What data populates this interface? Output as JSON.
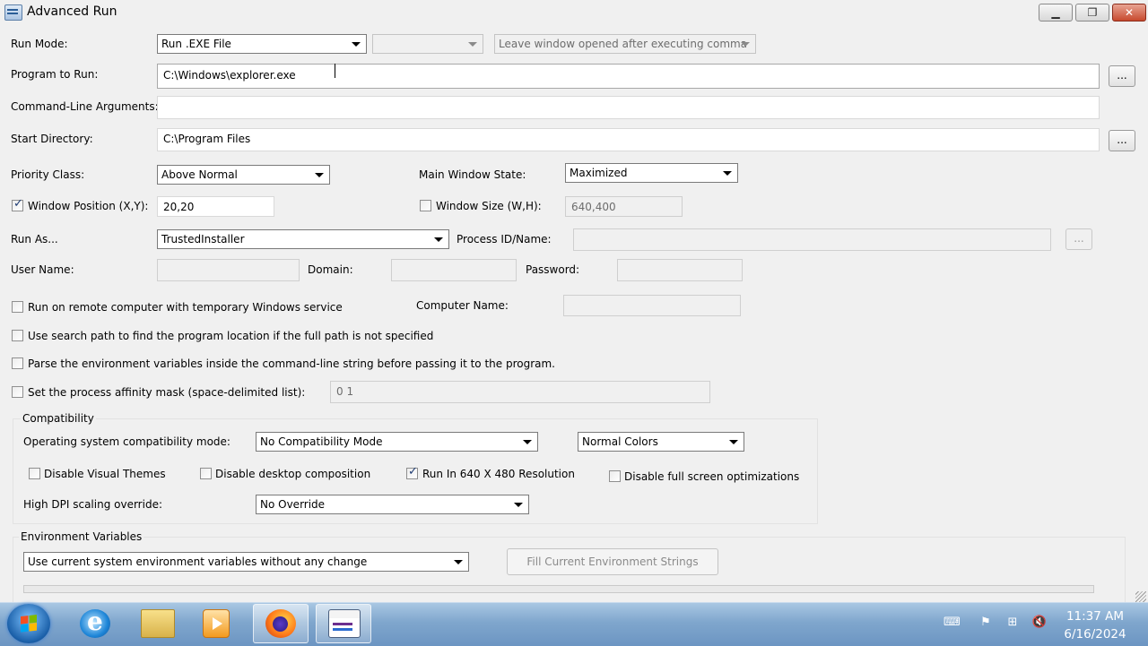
{
  "window": {
    "title": "Advanced Run",
    "minimize": "▁",
    "maximize": "❐",
    "close": "✕"
  },
  "run_mode": {
    "label": "Run Mode:",
    "value": "Run .EXE File",
    "secondary_value": "",
    "after_exec_value": "Leave window opened after executing comma"
  },
  "program": {
    "label": "Program to Run:",
    "value": "C:\\Windows\\explorer.exe",
    "browse": "..."
  },
  "cmdline": {
    "label": "Command-Line Arguments:",
    "value": ""
  },
  "start_dir": {
    "label": "Start Directory:",
    "value": "C:\\Program Files",
    "browse": "..."
  },
  "priority": {
    "label": "Priority Class:",
    "value": "Above Normal"
  },
  "main_window_state": {
    "label": "Main Window State:",
    "value": "Maximized"
  },
  "window_position": {
    "label": "Window Position (X,Y):",
    "value": "20,20",
    "checked": true
  },
  "window_size": {
    "label": "Window Size (W,H):",
    "value": "640,400",
    "checked": false
  },
  "run_as": {
    "label": "Run As...",
    "value": "TrustedInstaller"
  },
  "process_id": {
    "label": "Process ID/Name:",
    "value": "",
    "browse": "..."
  },
  "user_name": {
    "label": "User Name:",
    "value": ""
  },
  "domain": {
    "label": "Domain:",
    "value": ""
  },
  "password": {
    "label": "Password:",
    "value": ""
  },
  "remote": {
    "label": "Run on remote computer with temporary Windows service",
    "checked": false
  },
  "computer_name": {
    "label": "Computer Name:",
    "value": ""
  },
  "search_path": {
    "label": "Use search path to find the program location if the full path is not specified",
    "checked": false
  },
  "parse_env": {
    "label": "Parse the environment variables inside the command-line string before passing it to the program.",
    "checked": false
  },
  "affinity": {
    "label": "Set the process affinity mask (space-delimited list):",
    "value": "0 1",
    "checked": false
  },
  "compatibility": {
    "title": "Compatibility",
    "os_mode_label": "Operating system compatibility mode:",
    "os_mode_value": "No Compatibility Mode",
    "colors_value": "Normal Colors",
    "disable_visual_themes": {
      "label": "Disable Visual Themes",
      "checked": false
    },
    "disable_desktop_composition": {
      "label": "Disable desktop composition",
      "checked": false
    },
    "run_640x480": {
      "label": "Run In 640 X 480 Resolution",
      "checked": true
    },
    "disable_fullscreen_opt": {
      "label": "Disable full screen optimizations",
      "checked": false
    },
    "dpi_label": "High DPI scaling override:",
    "dpi_value": "No Override"
  },
  "environment": {
    "title": "Environment Variables",
    "mode_value": "Use current system environment variables without any change",
    "fill_button": "Fill Current Environment Strings"
  },
  "taskbar": {
    "tray": {
      "keyboard": "⌨",
      "flag": "⚑",
      "network": "⊞",
      "volume": "🔇"
    },
    "clock_time": "11:37 AM",
    "clock_date": "6/16/2024"
  }
}
